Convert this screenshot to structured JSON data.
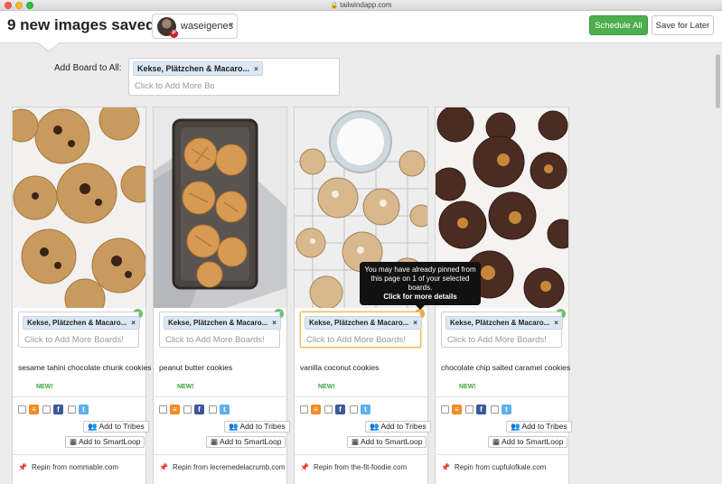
{
  "window": {
    "url": "tailwindapp.com"
  },
  "header": {
    "title": "9 new images saved!",
    "account_name": "waseigenes",
    "schedule_all": "Schedule All",
    "save_for_later": "Save for Later"
  },
  "add_board": {
    "label": "Add Board to All:",
    "chip": "Kekse, Plätzchen & Macaro...",
    "placeholder": "Click to Add More Boa"
  },
  "common": {
    "chip_remove": "×",
    "board_placeholder": "Click to Add More Boards!",
    "new_badge": "NEW!",
    "add_tribes": "Add to Tribes",
    "add_smartloop": "Add to SmartLoop"
  },
  "cards": [
    {
      "chip": "Kekse, Plätzchen & Macaro...",
      "description": "sesame tahini chocolate chunk cookies",
      "repin": "Repin from nommable.com",
      "status": "ok"
    },
    {
      "chip": "Kekse, Plätzchen & Macaro...",
      "description": "peanut butter cookies",
      "repin": "Repin from lecremedelacrumb.com",
      "status": "ok"
    },
    {
      "chip": "Kekse, Plätzchen & Macaro...",
      "description": "vanilla coconut cookies",
      "repin": "Repin from the-fit-foodie.com",
      "status": "warning"
    },
    {
      "chip": "Kekse, Plätzchen & Macaro...",
      "description": "chocolate chip salted caramel cookies",
      "repin": "Repin from cupfulofkale.com",
      "status": "ok"
    }
  ],
  "tooltip": {
    "text": "You may have already pinned from this page on 1 of your selected boards.",
    "link": "Click for more details"
  },
  "icons": {
    "status_ok": "check-circle-icon",
    "status_warning": "warning-circle-icon",
    "rss": "rss-icon",
    "facebook": "facebook-icon",
    "twitter": "twitter-icon",
    "tribes": "people-icon",
    "smartloop": "grid-icon",
    "repin": "pushpin-icon"
  },
  "colors": {
    "schedule_button": "#4cae4c",
    "new_badge": "#39a839",
    "rss": "#f18c26",
    "facebook": "#3b5998",
    "twitter": "#5eb0e8",
    "warning": "#f0a63a"
  }
}
